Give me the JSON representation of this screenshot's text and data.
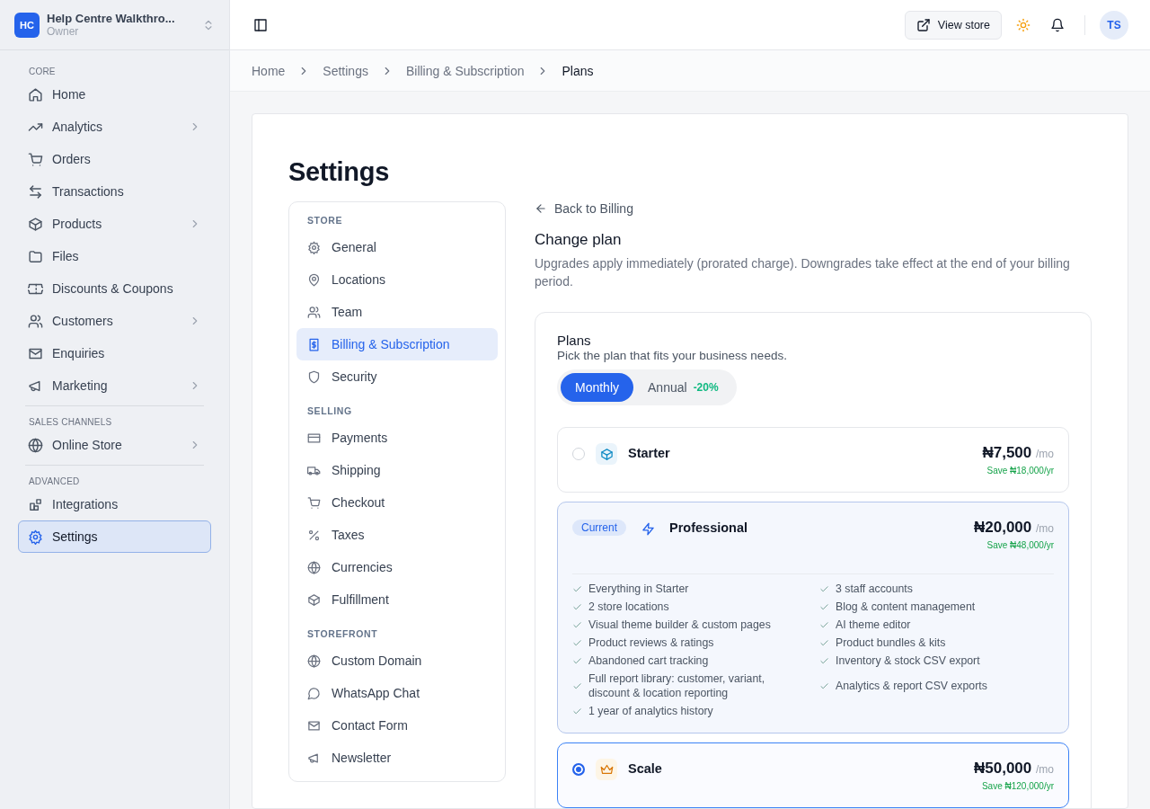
{
  "workspace": {
    "initials": "HC",
    "name": "Help Centre Walkthro...",
    "role": "Owner"
  },
  "sidebar": {
    "sections": [
      {
        "heading": "CORE",
        "items": [
          {
            "label": "Home",
            "has_submenu": false,
            "selected": false
          },
          {
            "label": "Analytics",
            "has_submenu": true,
            "selected": false
          },
          {
            "label": "Orders",
            "has_submenu": false,
            "selected": false
          },
          {
            "label": "Transactions",
            "has_submenu": false,
            "selected": false
          },
          {
            "label": "Products",
            "has_submenu": true,
            "selected": false
          },
          {
            "label": "Files",
            "has_submenu": false,
            "selected": false
          },
          {
            "label": "Discounts & Coupons",
            "has_submenu": false,
            "selected": false
          },
          {
            "label": "Customers",
            "has_submenu": true,
            "selected": false
          },
          {
            "label": "Enquiries",
            "has_submenu": false,
            "selected": false
          },
          {
            "label": "Marketing",
            "has_submenu": true,
            "selected": false
          }
        ]
      },
      {
        "heading": "SALES CHANNELS",
        "items": [
          {
            "label": "Online Store",
            "has_submenu": true,
            "selected": false
          }
        ]
      },
      {
        "heading": "ADVANCED",
        "items": [
          {
            "label": "Integrations",
            "has_submenu": false,
            "selected": false
          },
          {
            "label": "Settings",
            "has_submenu": false,
            "selected": true
          }
        ]
      }
    ]
  },
  "topbar": {
    "view_store": "View store",
    "avatar": "TS"
  },
  "breadcrumbs": [
    "Home",
    "Settings",
    "Billing & Subscription",
    "Plans"
  ],
  "page_title": "Settings",
  "settings_nav": [
    {
      "heading": "STORE",
      "items": [
        {
          "label": "General",
          "selected": false
        },
        {
          "label": "Locations",
          "selected": false
        },
        {
          "label": "Team",
          "selected": false
        },
        {
          "label": "Billing & Subscription",
          "selected": true
        },
        {
          "label": "Security",
          "selected": false
        }
      ]
    },
    {
      "heading": "SELLING",
      "items": [
        {
          "label": "Payments",
          "selected": false
        },
        {
          "label": "Shipping",
          "selected": false
        },
        {
          "label": "Checkout",
          "selected": false
        },
        {
          "label": "Taxes",
          "selected": false
        },
        {
          "label": "Currencies",
          "selected": false
        },
        {
          "label": "Fulfillment",
          "selected": false
        }
      ]
    },
    {
      "heading": "STOREFRONT",
      "items": [
        {
          "label": "Custom Domain",
          "selected": false
        },
        {
          "label": "WhatsApp Chat",
          "selected": false
        },
        {
          "label": "Contact Form",
          "selected": false
        },
        {
          "label": "Newsletter",
          "selected": false
        }
      ]
    }
  ],
  "back_link": "Back to Billing",
  "change_plan": {
    "title": "Change plan",
    "description": "Upgrades apply immediately (prorated charge). Downgrades take effect at the end of your billing period."
  },
  "plans_panel": {
    "title": "Plans",
    "subtitle": "Pick the plan that fits your business needs.",
    "billing_toggle": [
      {
        "label": "Monthly",
        "selected": true
      },
      {
        "label": "Annual",
        "discount": "-20%",
        "selected": false
      }
    ],
    "plans": [
      {
        "name": "Starter",
        "price": "₦7,500",
        "period": "/mo",
        "savings": "Save ₦18,000/yr",
        "current": false,
        "selected": false
      },
      {
        "name": "Professional",
        "badge": "Current",
        "price": "₦20,000",
        "period": "/mo",
        "savings": "Save ₦48,000/yr",
        "current": true,
        "selected": false,
        "features": [
          "Everything in Starter",
          "3 staff accounts",
          "2 store locations",
          "Blog & content management",
          "Visual theme builder & custom pages",
          "AI theme editor",
          "Product reviews & ratings",
          "Product bundles & kits",
          "Abandoned cart tracking",
          "Inventory & stock CSV export",
          "Full report library: customer, variant, discount & location reporting",
          "Analytics & report CSV exports",
          "1 year of analytics history"
        ]
      },
      {
        "name": "Scale",
        "price": "₦50,000",
        "period": "/mo",
        "savings": "Save ₦120,000/yr",
        "current": false,
        "selected": true
      }
    ]
  }
}
